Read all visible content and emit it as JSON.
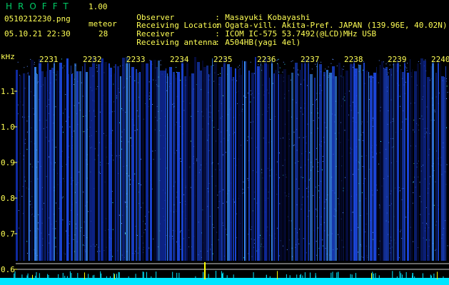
{
  "header": {
    "app_title": "HROFFT",
    "version": "1.00",
    "filename": "0510212230.png",
    "datetime": "05.10.21 22:30",
    "meteor_label": "meteor",
    "meteor_count": "28"
  },
  "info": [
    {
      "key": "Observer",
      "value": "Masayuki Kobayashi"
    },
    {
      "key": "Receiving Location",
      "value": "Ogata-vill. Akita-Pref. JAPAN (139.96E, 40.02N)"
    },
    {
      "key": "Receiver",
      "value": "ICOM IC-575 53.7492(@LCD)MHz USB"
    },
    {
      "key": "Receiving antenna",
      "value": "A504HB(yagi 4el)"
    }
  ],
  "spectrogram": {
    "y_unit": "kHz",
    "y_ticks": [
      "1.1",
      "1.0",
      "0.9",
      "0.8",
      "0.7",
      "0.6"
    ],
    "time_labels": [
      "2231",
      "2232",
      "2233",
      "2234",
      "2235",
      "2236",
      "2237",
      "2238",
      "2239",
      "2240"
    ],
    "colors": {
      "background": "#000000",
      "label": "#ffff55",
      "signal": "#2a5cff",
      "baseline": "#00e5ff",
      "marker": "#ffff00"
    }
  }
}
